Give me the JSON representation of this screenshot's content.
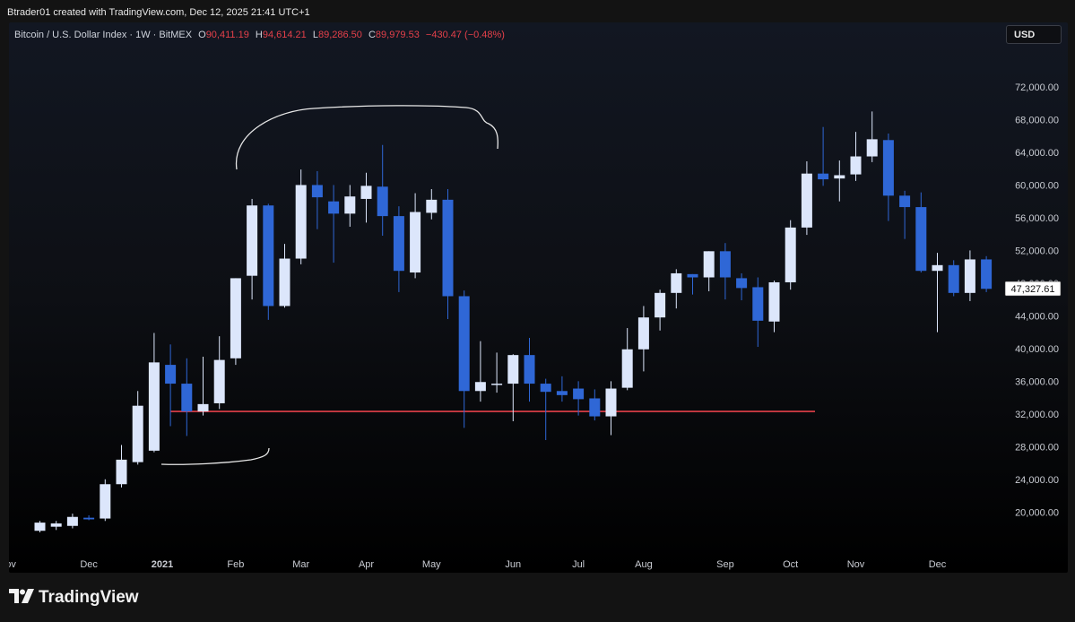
{
  "header": {
    "attribution": "Btrader01 created with TradingView.com, Dec 12, 2025 21:41 UTC+1"
  },
  "legend": {
    "symbol": "Bitcoin / U.S. Dollar Index · 1W · BitMEX",
    "o_label": "O",
    "o_value": "90,411.19",
    "h_label": "H",
    "h_value": "94,614.21",
    "l_label": "L",
    "l_value": "89,286.50",
    "c_label": "C",
    "c_value": "89,979.53",
    "change": "−430.47 (−0.48%)"
  },
  "currency_button": "USD",
  "brand": {
    "name": "TradingView"
  },
  "colors": {
    "up": "#dce6fb",
    "down": "#2f67d6",
    "support_line": "#e5404a",
    "price_tag_bg": "#ffffff",
    "axis_text": "#c9ccd3"
  },
  "chart_data": {
    "type": "candlestick",
    "symbol": "Bitcoin / U.S. Dollar Index",
    "timeframe": "1W",
    "ylim": [
      17000,
      74500
    ],
    "y_ticks": [
      20000,
      24000,
      28000,
      32000,
      36000,
      40000,
      44000,
      48000,
      52000,
      56000,
      60000,
      64000,
      68000,
      72000
    ],
    "y_tick_labels": [
      "20,000.00",
      "24,000.00",
      "28,000.00",
      "32,000.00",
      "36,000.00",
      "40,000.00",
      "44,000.00",
      "48,000.00",
      "52,000.00",
      "56,000.00",
      "60,000.00",
      "64,000.00",
      "68,000.00",
      "72,000.00"
    ],
    "x_labels": [
      {
        "label": "Nov",
        "week": -2
      },
      {
        "label": "Dec",
        "week": 3
      },
      {
        "label": "2021",
        "week": 7.5,
        "bold": true
      },
      {
        "label": "Feb",
        "week": 12
      },
      {
        "label": "Mar",
        "week": 16
      },
      {
        "label": "Apr",
        "week": 20
      },
      {
        "label": "May",
        "week": 24
      },
      {
        "label": "Jun",
        "week": 29
      },
      {
        "label": "Jul",
        "week": 33
      },
      {
        "label": "Aug",
        "week": 37
      },
      {
        "label": "Sep",
        "week": 42
      },
      {
        "label": "Oct",
        "week": 46
      },
      {
        "label": "Nov",
        "week": 50
      },
      {
        "label": "Dec",
        "week": 55
      }
    ],
    "last_price_label": "47,327.61",
    "last_price": 47327.61,
    "support_level": {
      "price": 32300,
      "from_week": 8,
      "to_week": 47.5
    },
    "candles": [
      {
        "o": 17700,
        "h": 18900,
        "l": 17500,
        "c": 18700
      },
      {
        "o": 18200,
        "h": 18900,
        "l": 17800,
        "c": 18600
      },
      {
        "o": 18300,
        "h": 19800,
        "l": 18000,
        "c": 19400
      },
      {
        "o": 19300,
        "h": 19600,
        "l": 19000,
        "c": 19100
      },
      {
        "o": 19200,
        "h": 24000,
        "l": 18900,
        "c": 23400
      },
      {
        "o": 23400,
        "h": 28200,
        "l": 23000,
        "c": 26400
      },
      {
        "o": 26100,
        "h": 34800,
        "l": 25800,
        "c": 33000
      },
      {
        "o": 27500,
        "h": 41900,
        "l": 27300,
        "c": 38300
      },
      {
        "o": 38000,
        "h": 40500,
        "l": 30500,
        "c": 35700
      },
      {
        "o": 35700,
        "h": 38800,
        "l": 29300,
        "c": 32300
      },
      {
        "o": 32300,
        "h": 39000,
        "l": 31800,
        "c": 33200
      },
      {
        "o": 33300,
        "h": 41500,
        "l": 32600,
        "c": 38600
      },
      {
        "o": 38800,
        "h": 48500,
        "l": 38000,
        "c": 48600
      },
      {
        "o": 48900,
        "h": 58300,
        "l": 46000,
        "c": 57500
      },
      {
        "o": 57500,
        "h": 57700,
        "l": 43500,
        "c": 45200
      },
      {
        "o": 45200,
        "h": 52800,
        "l": 45000,
        "c": 51000
      },
      {
        "o": 51000,
        "h": 61900,
        "l": 50300,
        "c": 60000
      },
      {
        "o": 60000,
        "h": 61700,
        "l": 54600,
        "c": 58500
      },
      {
        "o": 58000,
        "h": 60000,
        "l": 50500,
        "c": 56500
      },
      {
        "o": 56500,
        "h": 60000,
        "l": 54900,
        "c": 58600
      },
      {
        "o": 58300,
        "h": 61500,
        "l": 55400,
        "c": 59900
      },
      {
        "o": 59800,
        "h": 64900,
        "l": 53800,
        "c": 56200
      },
      {
        "o": 56200,
        "h": 57400,
        "l": 46900,
        "c": 49500
      },
      {
        "o": 49300,
        "h": 59000,
        "l": 48600,
        "c": 56700
      },
      {
        "o": 56600,
        "h": 59500,
        "l": 55800,
        "c": 58200
      },
      {
        "o": 58200,
        "h": 59500,
        "l": 43600,
        "c": 46400
      },
      {
        "o": 46400,
        "h": 47100,
        "l": 30300,
        "c": 34800
      },
      {
        "o": 34800,
        "h": 40900,
        "l": 33500,
        "c": 35900
      },
      {
        "o": 35700,
        "h": 39500,
        "l": 34600,
        "c": 35700
      },
      {
        "o": 35700,
        "h": 39300,
        "l": 31100,
        "c": 39200
      },
      {
        "o": 39200,
        "h": 41300,
        "l": 33500,
        "c": 35700
      },
      {
        "o": 35700,
        "h": 36300,
        "l": 28800,
        "c": 34700
      },
      {
        "o": 34800,
        "h": 36600,
        "l": 33500,
        "c": 34300
      },
      {
        "o": 35100,
        "h": 36000,
        "l": 31800,
        "c": 33800
      },
      {
        "o": 33900,
        "h": 35000,
        "l": 31200,
        "c": 31700
      },
      {
        "o": 31700,
        "h": 36000,
        "l": 29400,
        "c": 35100
      },
      {
        "o": 35200,
        "h": 42500,
        "l": 34900,
        "c": 39900
      },
      {
        "o": 39900,
        "h": 45200,
        "l": 37200,
        "c": 43800
      },
      {
        "o": 43800,
        "h": 47200,
        "l": 42200,
        "c": 46800
      },
      {
        "o": 46800,
        "h": 49700,
        "l": 44900,
        "c": 49200
      },
      {
        "o": 49100,
        "h": 48400,
        "l": 46600,
        "c": 48700
      },
      {
        "o": 48700,
        "h": 51000,
        "l": 47000,
        "c": 51900
      },
      {
        "o": 51900,
        "h": 52900,
        "l": 46000,
        "c": 48700
      },
      {
        "o": 48600,
        "h": 49200,
        "l": 45900,
        "c": 47400
      },
      {
        "o": 47500,
        "h": 48700,
        "l": 40200,
        "c": 43400
      },
      {
        "o": 43300,
        "h": 48300,
        "l": 42000,
        "c": 48100
      },
      {
        "o": 48100,
        "h": 55700,
        "l": 47200,
        "c": 54800
      },
      {
        "o": 54800,
        "h": 62900,
        "l": 53900,
        "c": 61400
      },
      {
        "o": 61400,
        "h": 67100,
        "l": 59900,
        "c": 60700
      },
      {
        "o": 60800,
        "h": 63000,
        "l": 58000,
        "c": 61200
      },
      {
        "o": 61300,
        "h": 66500,
        "l": 60500,
        "c": 63500
      },
      {
        "o": 63500,
        "h": 69000,
        "l": 62800,
        "c": 65600
      },
      {
        "o": 65500,
        "h": 66300,
        "l": 55600,
        "c": 58700
      },
      {
        "o": 58700,
        "h": 59300,
        "l": 53400,
        "c": 57300
      },
      {
        "o": 57300,
        "h": 59100,
        "l": 49300,
        "c": 49500
      },
      {
        "o": 49500,
        "h": 51700,
        "l": 42000,
        "c": 50200
      },
      {
        "o": 50200,
        "h": 50800,
        "l": 46400,
        "c": 46800
      },
      {
        "o": 46800,
        "h": 52000,
        "l": 45800,
        "c": 50900
      },
      {
        "o": 50900,
        "h": 51300,
        "l": 46900,
        "c": 47300
      }
    ]
  }
}
